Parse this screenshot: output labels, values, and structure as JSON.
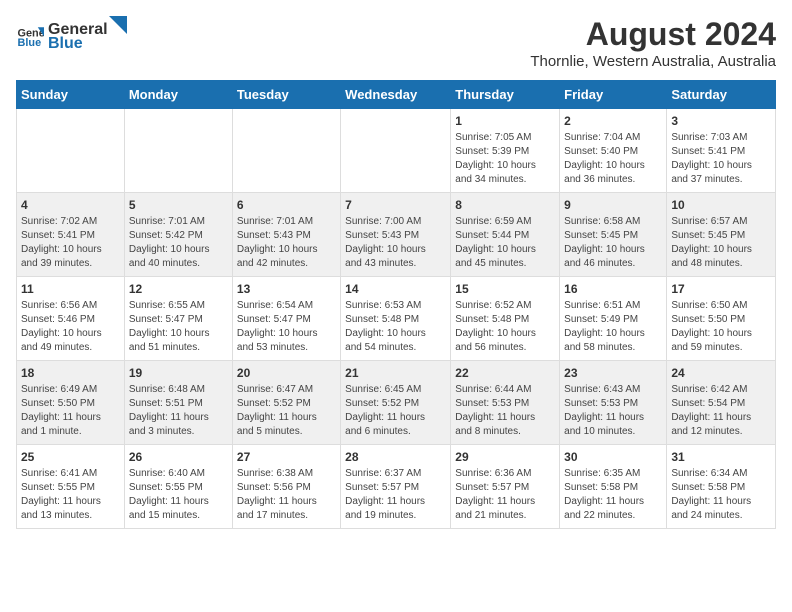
{
  "logo": {
    "general": "General",
    "blue": "Blue"
  },
  "title": "August 2024",
  "location": "Thornlie, Western Australia, Australia",
  "days": [
    "Sunday",
    "Monday",
    "Tuesday",
    "Wednesday",
    "Thursday",
    "Friday",
    "Saturday"
  ],
  "weeks": [
    [
      {
        "date": "",
        "info": ""
      },
      {
        "date": "",
        "info": ""
      },
      {
        "date": "",
        "info": ""
      },
      {
        "date": "",
        "info": ""
      },
      {
        "date": "1",
        "info": "Sunrise: 7:05 AM\nSunset: 5:39 PM\nDaylight: 10 hours\nand 34 minutes."
      },
      {
        "date": "2",
        "info": "Sunrise: 7:04 AM\nSunset: 5:40 PM\nDaylight: 10 hours\nand 36 minutes."
      },
      {
        "date": "3",
        "info": "Sunrise: 7:03 AM\nSunset: 5:41 PM\nDaylight: 10 hours\nand 37 minutes."
      }
    ],
    [
      {
        "date": "4",
        "info": "Sunrise: 7:02 AM\nSunset: 5:41 PM\nDaylight: 10 hours\nand 39 minutes."
      },
      {
        "date": "5",
        "info": "Sunrise: 7:01 AM\nSunset: 5:42 PM\nDaylight: 10 hours\nand 40 minutes."
      },
      {
        "date": "6",
        "info": "Sunrise: 7:01 AM\nSunset: 5:43 PM\nDaylight: 10 hours\nand 42 minutes."
      },
      {
        "date": "7",
        "info": "Sunrise: 7:00 AM\nSunset: 5:43 PM\nDaylight: 10 hours\nand 43 minutes."
      },
      {
        "date": "8",
        "info": "Sunrise: 6:59 AM\nSunset: 5:44 PM\nDaylight: 10 hours\nand 45 minutes."
      },
      {
        "date": "9",
        "info": "Sunrise: 6:58 AM\nSunset: 5:45 PM\nDaylight: 10 hours\nand 46 minutes."
      },
      {
        "date": "10",
        "info": "Sunrise: 6:57 AM\nSunset: 5:45 PM\nDaylight: 10 hours\nand 48 minutes."
      }
    ],
    [
      {
        "date": "11",
        "info": "Sunrise: 6:56 AM\nSunset: 5:46 PM\nDaylight: 10 hours\nand 49 minutes."
      },
      {
        "date": "12",
        "info": "Sunrise: 6:55 AM\nSunset: 5:47 PM\nDaylight: 10 hours\nand 51 minutes."
      },
      {
        "date": "13",
        "info": "Sunrise: 6:54 AM\nSunset: 5:47 PM\nDaylight: 10 hours\nand 53 minutes."
      },
      {
        "date": "14",
        "info": "Sunrise: 6:53 AM\nSunset: 5:48 PM\nDaylight: 10 hours\nand 54 minutes."
      },
      {
        "date": "15",
        "info": "Sunrise: 6:52 AM\nSunset: 5:48 PM\nDaylight: 10 hours\nand 56 minutes."
      },
      {
        "date": "16",
        "info": "Sunrise: 6:51 AM\nSunset: 5:49 PM\nDaylight: 10 hours\nand 58 minutes."
      },
      {
        "date": "17",
        "info": "Sunrise: 6:50 AM\nSunset: 5:50 PM\nDaylight: 10 hours\nand 59 minutes."
      }
    ],
    [
      {
        "date": "18",
        "info": "Sunrise: 6:49 AM\nSunset: 5:50 PM\nDaylight: 11 hours\nand 1 minute."
      },
      {
        "date": "19",
        "info": "Sunrise: 6:48 AM\nSunset: 5:51 PM\nDaylight: 11 hours\nand 3 minutes."
      },
      {
        "date": "20",
        "info": "Sunrise: 6:47 AM\nSunset: 5:52 PM\nDaylight: 11 hours\nand 5 minutes."
      },
      {
        "date": "21",
        "info": "Sunrise: 6:45 AM\nSunset: 5:52 PM\nDaylight: 11 hours\nand 6 minutes."
      },
      {
        "date": "22",
        "info": "Sunrise: 6:44 AM\nSunset: 5:53 PM\nDaylight: 11 hours\nand 8 minutes."
      },
      {
        "date": "23",
        "info": "Sunrise: 6:43 AM\nSunset: 5:53 PM\nDaylight: 11 hours\nand 10 minutes."
      },
      {
        "date": "24",
        "info": "Sunrise: 6:42 AM\nSunset: 5:54 PM\nDaylight: 11 hours\nand 12 minutes."
      }
    ],
    [
      {
        "date": "25",
        "info": "Sunrise: 6:41 AM\nSunset: 5:55 PM\nDaylight: 11 hours\nand 13 minutes."
      },
      {
        "date": "26",
        "info": "Sunrise: 6:40 AM\nSunset: 5:55 PM\nDaylight: 11 hours\nand 15 minutes."
      },
      {
        "date": "27",
        "info": "Sunrise: 6:38 AM\nSunset: 5:56 PM\nDaylight: 11 hours\nand 17 minutes."
      },
      {
        "date": "28",
        "info": "Sunrise: 6:37 AM\nSunset: 5:57 PM\nDaylight: 11 hours\nand 19 minutes."
      },
      {
        "date": "29",
        "info": "Sunrise: 6:36 AM\nSunset: 5:57 PM\nDaylight: 11 hours\nand 21 minutes."
      },
      {
        "date": "30",
        "info": "Sunrise: 6:35 AM\nSunset: 5:58 PM\nDaylight: 11 hours\nand 22 minutes."
      },
      {
        "date": "31",
        "info": "Sunrise: 6:34 AM\nSunset: 5:58 PM\nDaylight: 11 hours\nand 24 minutes."
      }
    ]
  ]
}
